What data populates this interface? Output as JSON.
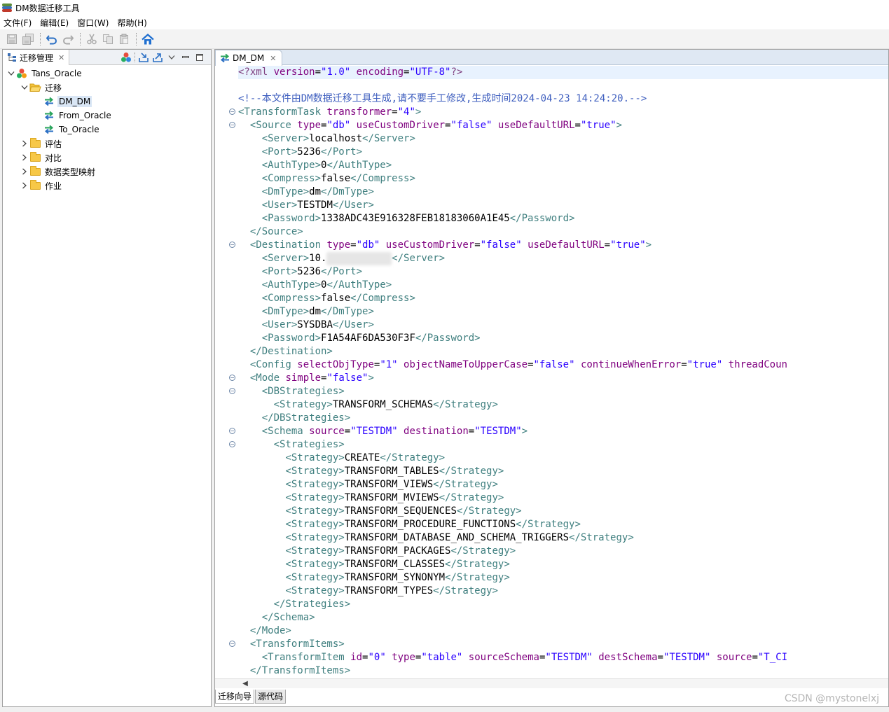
{
  "window": {
    "title": "DM数据迁移工具"
  },
  "menu": [
    "文件(F)",
    "编辑(E)",
    "窗口(W)",
    "帮助(H)"
  ],
  "left_panel": {
    "tab_label": "迁移管理",
    "tree": [
      {
        "label": "Tans_Oracle",
        "icon": "project-icon",
        "level": 0,
        "expanded": true
      },
      {
        "label": "迁移",
        "icon": "folder-open-icon",
        "level": 1,
        "expanded": true
      },
      {
        "label": "DM_DM",
        "icon": "transfer-icon",
        "level": 2,
        "selected": true
      },
      {
        "label": "From_Oracle",
        "icon": "transfer-icon",
        "level": 2
      },
      {
        "label": "To_Oracle",
        "icon": "transfer-icon",
        "level": 2
      },
      {
        "label": "评估",
        "icon": "folder-icon",
        "level": 1,
        "expanded": false
      },
      {
        "label": "对比",
        "icon": "folder-icon",
        "level": 1,
        "expanded": false
      },
      {
        "label": "数据类型映射",
        "icon": "folder-icon",
        "level": 1,
        "expanded": false
      },
      {
        "label": "作业",
        "icon": "folder-icon",
        "level": 1,
        "expanded": false
      }
    ]
  },
  "editor": {
    "tab_label": "DM_DM",
    "bottom_tabs": [
      "迁移向导",
      "源代码"
    ],
    "active_bottom_tab": 1,
    "lines": [
      {
        "fold": false,
        "hl": true,
        "segs": [
          [
            "decl",
            "<?xml "
          ],
          [
            "attr",
            "version"
          ],
          [
            "text",
            "="
          ],
          [
            "val",
            "\"1.0\""
          ],
          [
            "attr",
            " encoding"
          ],
          [
            "text",
            "="
          ],
          [
            "val",
            "\"UTF-8\""
          ],
          [
            "decl",
            "?>"
          ]
        ]
      },
      {
        "fold": false,
        "segs": []
      },
      {
        "fold": false,
        "segs": [
          [
            "com",
            "<!--本文件由DM数据迁移工具生成,请不要手工修改,生成时间2024-04-23 14:24:20.-->"
          ]
        ]
      },
      {
        "fold": true,
        "segs": [
          [
            "tag",
            "<TransformTask"
          ],
          [
            "attr",
            " transformer"
          ],
          [
            "text",
            "="
          ],
          [
            "val",
            "\"4\""
          ],
          [
            "tag",
            ">"
          ]
        ]
      },
      {
        "fold": true,
        "segs": [
          [
            "text",
            "  "
          ],
          [
            "tag",
            "<Source"
          ],
          [
            "attr",
            " type"
          ],
          [
            "text",
            "="
          ],
          [
            "val",
            "\"db\""
          ],
          [
            "attr",
            " useCustomDriver"
          ],
          [
            "text",
            "="
          ],
          [
            "val",
            "\"false\""
          ],
          [
            "attr",
            " useDefaultURL"
          ],
          [
            "text",
            "="
          ],
          [
            "val",
            "\"true\""
          ],
          [
            "tag",
            ">"
          ]
        ]
      },
      {
        "fold": false,
        "segs": [
          [
            "text",
            "    "
          ],
          [
            "tag",
            "<Server>"
          ],
          [
            "text",
            "localhost"
          ],
          [
            "tag",
            "</Server>"
          ]
        ]
      },
      {
        "fold": false,
        "segs": [
          [
            "text",
            "    "
          ],
          [
            "tag",
            "<Port>"
          ],
          [
            "text",
            "5236"
          ],
          [
            "tag",
            "</Port>"
          ]
        ]
      },
      {
        "fold": false,
        "segs": [
          [
            "text",
            "    "
          ],
          [
            "tag",
            "<AuthType>"
          ],
          [
            "text",
            "0"
          ],
          [
            "tag",
            "</AuthType>"
          ]
        ]
      },
      {
        "fold": false,
        "segs": [
          [
            "text",
            "    "
          ],
          [
            "tag",
            "<Compress>"
          ],
          [
            "text",
            "false"
          ],
          [
            "tag",
            "</Compress>"
          ]
        ]
      },
      {
        "fold": false,
        "segs": [
          [
            "text",
            "    "
          ],
          [
            "tag",
            "<DmType>"
          ],
          [
            "text",
            "dm"
          ],
          [
            "tag",
            "</DmType>"
          ]
        ]
      },
      {
        "fold": false,
        "segs": [
          [
            "text",
            "    "
          ],
          [
            "tag",
            "<User>"
          ],
          [
            "text",
            "TESTDM"
          ],
          [
            "tag",
            "</User>"
          ]
        ]
      },
      {
        "fold": false,
        "segs": [
          [
            "text",
            "    "
          ],
          [
            "tag",
            "<Password>"
          ],
          [
            "text",
            "1338ADC43E916328FEB18183060A1E45"
          ],
          [
            "tag",
            "</Password>"
          ]
        ]
      },
      {
        "fold": false,
        "segs": [
          [
            "text",
            "  "
          ],
          [
            "tag",
            "</Source>"
          ]
        ]
      },
      {
        "fold": true,
        "segs": [
          [
            "text",
            "  "
          ],
          [
            "tag",
            "<Destination"
          ],
          [
            "attr",
            " type"
          ],
          [
            "text",
            "="
          ],
          [
            "val",
            "\"db\""
          ],
          [
            "attr",
            " useCustomDriver"
          ],
          [
            "text",
            "="
          ],
          [
            "val",
            "\"false\""
          ],
          [
            "attr",
            " useDefaultURL"
          ],
          [
            "text",
            "="
          ],
          [
            "val",
            "\"true\""
          ],
          [
            "tag",
            ">"
          ]
        ]
      },
      {
        "fold": false,
        "segs": [
          [
            "text",
            "    "
          ],
          [
            "tag",
            "<Server>"
          ],
          [
            "text",
            "10."
          ],
          [
            "blur",
            "1xx.xxx.xxx"
          ],
          [
            "tag",
            "</Server>"
          ]
        ]
      },
      {
        "fold": false,
        "segs": [
          [
            "text",
            "    "
          ],
          [
            "tag",
            "<Port>"
          ],
          [
            "text",
            "5236"
          ],
          [
            "tag",
            "</Port>"
          ]
        ]
      },
      {
        "fold": false,
        "segs": [
          [
            "text",
            "    "
          ],
          [
            "tag",
            "<AuthType>"
          ],
          [
            "text",
            "0"
          ],
          [
            "tag",
            "</AuthType>"
          ]
        ]
      },
      {
        "fold": false,
        "segs": [
          [
            "text",
            "    "
          ],
          [
            "tag",
            "<Compress>"
          ],
          [
            "text",
            "false"
          ],
          [
            "tag",
            "</Compress>"
          ]
        ]
      },
      {
        "fold": false,
        "segs": [
          [
            "text",
            "    "
          ],
          [
            "tag",
            "<DmType>"
          ],
          [
            "text",
            "dm"
          ],
          [
            "tag",
            "</DmType>"
          ]
        ]
      },
      {
        "fold": false,
        "segs": [
          [
            "text",
            "    "
          ],
          [
            "tag",
            "<User>"
          ],
          [
            "text",
            "SYSDBA"
          ],
          [
            "tag",
            "</User>"
          ]
        ]
      },
      {
        "fold": false,
        "segs": [
          [
            "text",
            "    "
          ],
          [
            "tag",
            "<Password>"
          ],
          [
            "text",
            "F1A54AF6DA530F3F"
          ],
          [
            "tag",
            "</Password>"
          ]
        ]
      },
      {
        "fold": false,
        "segs": [
          [
            "text",
            "  "
          ],
          [
            "tag",
            "</Destination>"
          ]
        ]
      },
      {
        "fold": false,
        "segs": [
          [
            "text",
            "  "
          ],
          [
            "tag",
            "<Config"
          ],
          [
            "attr",
            " selectObjType"
          ],
          [
            "text",
            "="
          ],
          [
            "val",
            "\"1\""
          ],
          [
            "attr",
            " objectNameToUpperCase"
          ],
          [
            "text",
            "="
          ],
          [
            "val",
            "\"false\""
          ],
          [
            "attr",
            " continueWhenError"
          ],
          [
            "text",
            "="
          ],
          [
            "val",
            "\"true\""
          ],
          [
            "attr",
            " threadCoun"
          ]
        ]
      },
      {
        "fold": true,
        "segs": [
          [
            "text",
            "  "
          ],
          [
            "tag",
            "<Mode"
          ],
          [
            "attr",
            " simple"
          ],
          [
            "text",
            "="
          ],
          [
            "val",
            "\"false\""
          ],
          [
            "tag",
            ">"
          ]
        ]
      },
      {
        "fold": true,
        "segs": [
          [
            "text",
            "    "
          ],
          [
            "tag",
            "<DBStrategies>"
          ]
        ]
      },
      {
        "fold": false,
        "segs": [
          [
            "text",
            "      "
          ],
          [
            "tag",
            "<Strategy>"
          ],
          [
            "text",
            "TRANSFORM_SCHEMAS"
          ],
          [
            "tag",
            "</Strategy>"
          ]
        ]
      },
      {
        "fold": false,
        "segs": [
          [
            "text",
            "    "
          ],
          [
            "tag",
            "</DBStrategies>"
          ]
        ]
      },
      {
        "fold": true,
        "segs": [
          [
            "text",
            "    "
          ],
          [
            "tag",
            "<Schema"
          ],
          [
            "attr",
            " source"
          ],
          [
            "text",
            "="
          ],
          [
            "val",
            "\"TESTDM\""
          ],
          [
            "attr",
            " destination"
          ],
          [
            "text",
            "="
          ],
          [
            "val",
            "\"TESTDM\""
          ],
          [
            "tag",
            ">"
          ]
        ]
      },
      {
        "fold": true,
        "segs": [
          [
            "text",
            "      "
          ],
          [
            "tag",
            "<Strategies>"
          ]
        ]
      },
      {
        "fold": false,
        "segs": [
          [
            "text",
            "        "
          ],
          [
            "tag",
            "<Strategy>"
          ],
          [
            "text",
            "CREATE"
          ],
          [
            "tag",
            "</Strategy>"
          ]
        ]
      },
      {
        "fold": false,
        "segs": [
          [
            "text",
            "        "
          ],
          [
            "tag",
            "<Strategy>"
          ],
          [
            "text",
            "TRANSFORM_TABLES"
          ],
          [
            "tag",
            "</Strategy>"
          ]
        ]
      },
      {
        "fold": false,
        "segs": [
          [
            "text",
            "        "
          ],
          [
            "tag",
            "<Strategy>"
          ],
          [
            "text",
            "TRANSFORM_VIEWS"
          ],
          [
            "tag",
            "</Strategy>"
          ]
        ]
      },
      {
        "fold": false,
        "segs": [
          [
            "text",
            "        "
          ],
          [
            "tag",
            "<Strategy>"
          ],
          [
            "text",
            "TRANSFORM_MVIEWS"
          ],
          [
            "tag",
            "</Strategy>"
          ]
        ]
      },
      {
        "fold": false,
        "segs": [
          [
            "text",
            "        "
          ],
          [
            "tag",
            "<Strategy>"
          ],
          [
            "text",
            "TRANSFORM_SEQUENCES"
          ],
          [
            "tag",
            "</Strategy>"
          ]
        ]
      },
      {
        "fold": false,
        "segs": [
          [
            "text",
            "        "
          ],
          [
            "tag",
            "<Strategy>"
          ],
          [
            "text",
            "TRANSFORM_PROCEDURE_FUNCTIONS"
          ],
          [
            "tag",
            "</Strategy>"
          ]
        ]
      },
      {
        "fold": false,
        "segs": [
          [
            "text",
            "        "
          ],
          [
            "tag",
            "<Strategy>"
          ],
          [
            "text",
            "TRANSFORM_DATABASE_AND_SCHEMA_TRIGGERS"
          ],
          [
            "tag",
            "</Strategy>"
          ]
        ]
      },
      {
        "fold": false,
        "segs": [
          [
            "text",
            "        "
          ],
          [
            "tag",
            "<Strategy>"
          ],
          [
            "text",
            "TRANSFORM_PACKAGES"
          ],
          [
            "tag",
            "</Strategy>"
          ]
        ]
      },
      {
        "fold": false,
        "segs": [
          [
            "text",
            "        "
          ],
          [
            "tag",
            "<Strategy>"
          ],
          [
            "text",
            "TRANSFORM_CLASSES"
          ],
          [
            "tag",
            "</Strategy>"
          ]
        ]
      },
      {
        "fold": false,
        "segs": [
          [
            "text",
            "        "
          ],
          [
            "tag",
            "<Strategy>"
          ],
          [
            "text",
            "TRANSFORM_SYNONYM"
          ],
          [
            "tag",
            "</Strategy>"
          ]
        ]
      },
      {
        "fold": false,
        "segs": [
          [
            "text",
            "        "
          ],
          [
            "tag",
            "<Strategy>"
          ],
          [
            "text",
            "TRANSFORM_TYPES"
          ],
          [
            "tag",
            "</Strategy>"
          ]
        ]
      },
      {
        "fold": false,
        "segs": [
          [
            "text",
            "      "
          ],
          [
            "tag",
            "</Strategies>"
          ]
        ]
      },
      {
        "fold": false,
        "segs": [
          [
            "text",
            "    "
          ],
          [
            "tag",
            "</Schema>"
          ]
        ]
      },
      {
        "fold": false,
        "segs": [
          [
            "text",
            "  "
          ],
          [
            "tag",
            "</Mode>"
          ]
        ]
      },
      {
        "fold": true,
        "segs": [
          [
            "text",
            "  "
          ],
          [
            "tag",
            "<TransformItems>"
          ]
        ]
      },
      {
        "fold": false,
        "segs": [
          [
            "text",
            "    "
          ],
          [
            "tag",
            "<TransformItem"
          ],
          [
            "attr",
            " id"
          ],
          [
            "text",
            "="
          ],
          [
            "val",
            "\"0\""
          ],
          [
            "attr",
            " type"
          ],
          [
            "text",
            "="
          ],
          [
            "val",
            "\"table\""
          ],
          [
            "attr",
            " sourceSchema"
          ],
          [
            "text",
            "="
          ],
          [
            "val",
            "\"TESTDM\""
          ],
          [
            "attr",
            " destSchema"
          ],
          [
            "text",
            "="
          ],
          [
            "val",
            "\"TESTDM\""
          ],
          [
            "attr",
            " source"
          ],
          [
            "text",
            "="
          ],
          [
            "val",
            "\"T_CI"
          ]
        ]
      },
      {
        "fold": false,
        "segs": [
          [
            "text",
            "  "
          ],
          [
            "tag",
            "</TransformItems>"
          ]
        ]
      }
    ]
  },
  "watermark": "CSDN @mystonelxj",
  "colors": {
    "tag": "#3f7f7f",
    "attribute": "#7f007f",
    "value": "#2a00ff",
    "comment": "#3f5fbf",
    "selection": "#d9e6f5",
    "current_line": "#e8f2fe",
    "home_icon": "#1f6fd0"
  }
}
